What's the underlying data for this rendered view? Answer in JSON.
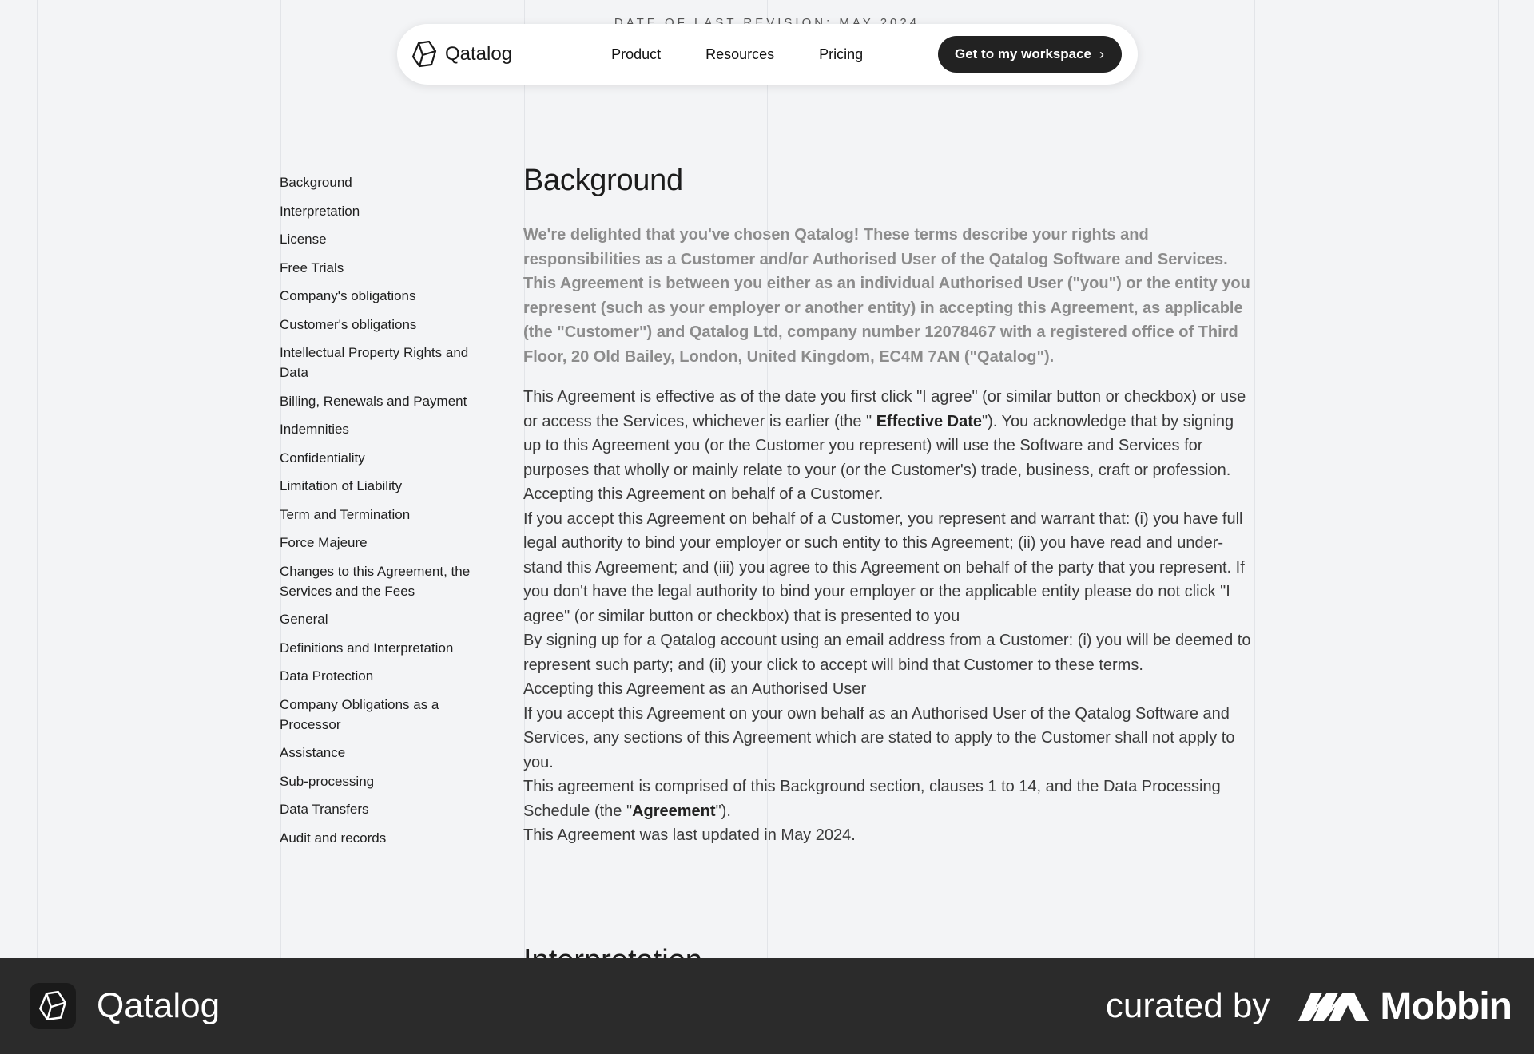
{
  "revision_text": "DATE OF LAST REVISION: MAY 2024",
  "nav": {
    "brand": "Qatalog",
    "links": [
      "Product",
      "Resources",
      "Pricing"
    ],
    "cta": "Get to my workspace"
  },
  "toc": [
    "Background",
    "Interpretation",
    "License",
    "Free Trials",
    "Company's obligations",
    "Customer's obligations",
    "Intellectual Property Rights and Data",
    "Billing, Renewals and Payment",
    "Indemnities",
    "Confidentiality",
    "Limitation of Liability",
    "Term and Termination",
    "Force Majeure",
    "Changes to this Agreement, the Services and the Fees",
    "General",
    "Definitions and Interpretation",
    "Data Protection",
    "Company Obligations as a Processor",
    "Assistance",
    "Sub-processing",
    "Data Transfers",
    "Audit and records"
  ],
  "content": {
    "heading": "Background",
    "lead": "We're delighted that you've chosen Qatalog! These terms describe your rights and responsibilities as a Customer and/or Authorised User of the Qatalog Software and Services. This Agreement is between you either as an individual Authorised User (\"you\") or the entity you represent (such as your employer or another entity) in accepting this Agreement, as applicable (the \"Customer\") and Qatalog Ltd, company number 12078467 with a registered office of Third Floor, 20 Old Bailey, London, United Kingdom, EC4M 7AN (\"Qatalog\").",
    "p1_a": "This Agreement is effective as of the date you first click \"I agree\" (or similar button or checkbox) or use or access the Services, whichever is earlier (the \" ",
    "p1_b": "Effective Date",
    "p1_c": "\"). You acknowledge that by signing up to this Agreement you (or the Customer you represent) will use the Software and Services for purposes that wholly or mainly relate to your (or the Customer's) trade, business, craft or profession.",
    "p2": "Accepting this Agreement on behalf of a Customer.",
    "p3": "If you accept this Agreement on behalf of a Customer, you represent and warrant that: (i) you have full legal authority to bind your employer or such entity to this Agreement; (ii) you have read and under­stand this Agreement; and (iii) you agree to this Agreement on behalf of the party that you represent. If you don't have the legal authority to bind your employer or the applicable entity please do not click \"I agree\" (or similar button or checkbox) that is presented to you",
    "p4": "By signing up for a Qatalog account using an email address from a Customer: (i) you will be deemed to represent such party; and (ii) your click to accept will bind that Customer to these terms.",
    "p5": "Accepting this Agreement as an Authorised User",
    "p6": "If you accept this Agreement on your own behalf as an Authorised User of the Qatalog Software and Services, any sections of this Agreement which are stated to apply to the Customer shall not apply to you.",
    "p7_a": "This agreement is comprised of this Background section, clauses 1 to 14, and the Data Processing Schedule (the \"",
    "p7_b": "Agreement",
    "p7_c": "\").",
    "p8": "This Agreement was last updated in May 2024.",
    "next_heading": "Interpretation"
  },
  "footer": {
    "app_name": "Qatalog",
    "curated": "curated by",
    "mobbin": "Mobbin"
  }
}
